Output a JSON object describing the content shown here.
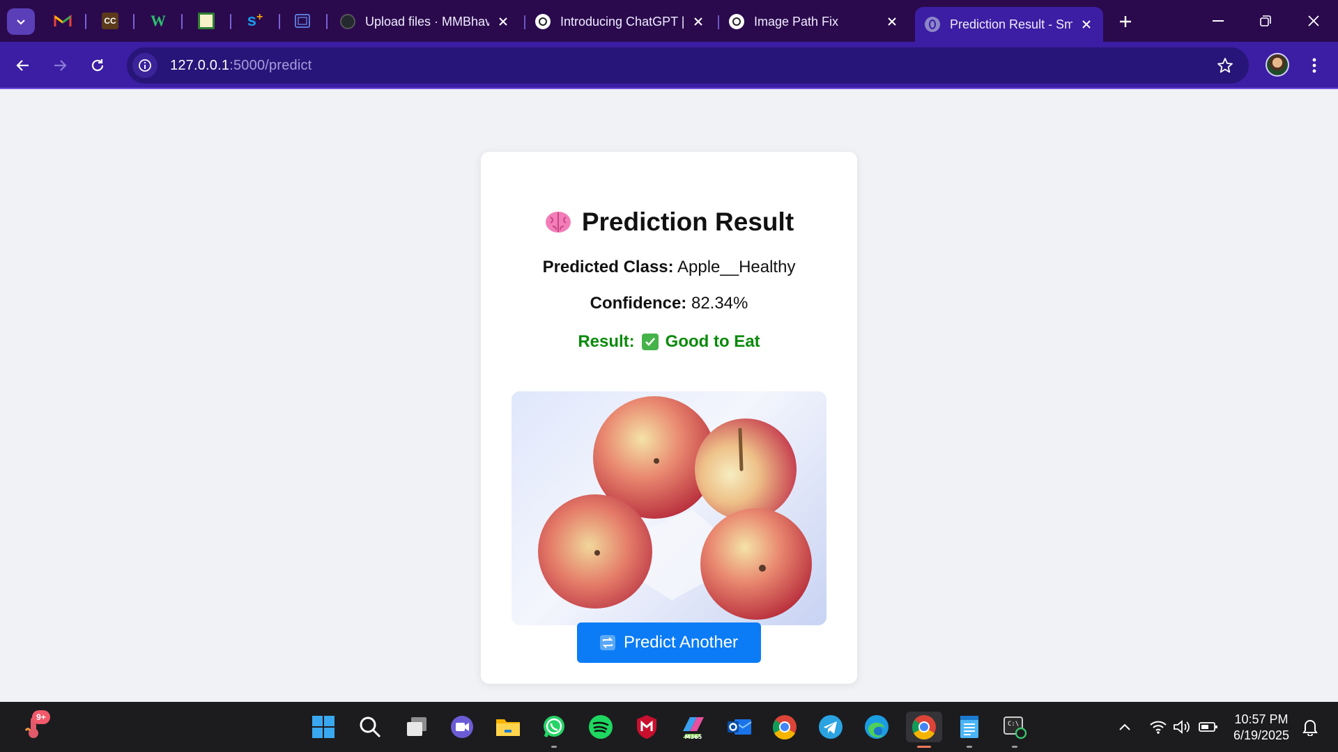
{
  "browser": {
    "tabs": [
      {
        "label": "Upload files · MMBhav",
        "favicon": "github-icon"
      },
      {
        "label": "Introducing ChatGPT |",
        "favicon": "chatgpt-icon"
      },
      {
        "label": "Image Path Fix",
        "favicon": "chatgpt-icon"
      },
      {
        "label": "Prediction Result - Sma",
        "favicon": "globe-icon",
        "active": true
      }
    ],
    "pinned_tabs": [
      "gmail-icon",
      "cc-icon",
      "w-icon",
      "sheet-icon",
      "s-plus-icon",
      "screen-icon"
    ],
    "url_host": "127.0.0.1",
    "url_path": ":5000/predict"
  },
  "card": {
    "title": "Prediction Result",
    "title_icon": "brain-icon",
    "predicted_class_label": "Predicted Class:",
    "predicted_class_value": "Apple__Healthy",
    "confidence_label": "Confidence:",
    "confidence_value": "82.34%",
    "result_label": "Result:",
    "result_value": "Good to Eat",
    "button_label": "Predict Another"
  },
  "taskbar": {
    "notification_badge": "9+",
    "time": "10:57 PM",
    "date": "6/19/2025"
  },
  "colors": {
    "tabstrip": "#2a0a4d",
    "toolbar": "#3b1ea3",
    "result_green": "#0a8a0a",
    "button_blue": "#0b7cf5"
  }
}
